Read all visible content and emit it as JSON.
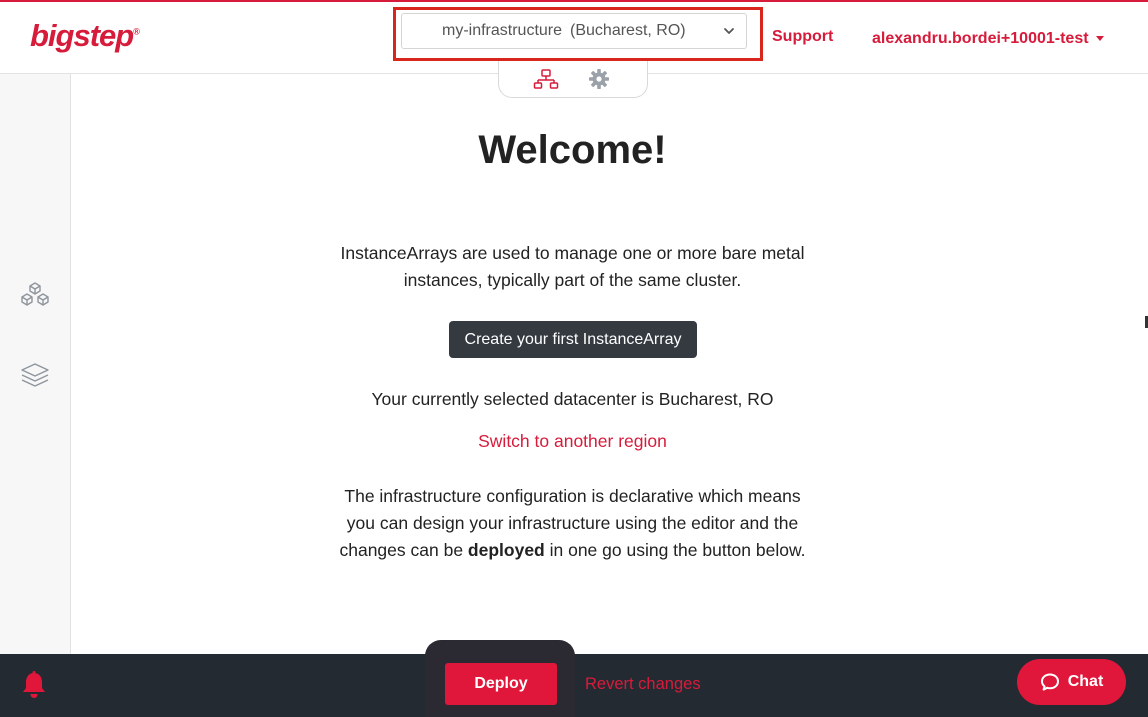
{
  "header": {
    "logo_text": "bigstep",
    "logo_mark": "®",
    "infrastructure_select": {
      "name": "my-infrastructure",
      "location": "(Bucharest, RO)"
    },
    "support_label": "Support",
    "user_label": "alexandru.bordei+10001-test"
  },
  "sidebar": {
    "items": [
      {
        "icon": "cubes-icon"
      },
      {
        "icon": "layers-icon"
      }
    ]
  },
  "view_toggle": {
    "items": [
      {
        "icon": "topology-icon",
        "active": true
      },
      {
        "icon": "gear-icon",
        "active": false
      }
    ]
  },
  "main": {
    "title": "Welcome!",
    "intro_line1": "InstanceArrays are used to manage one or more bare metal",
    "intro_line2": "instances, typically part of the same cluster.",
    "create_button_label": "Create your first InstanceArray",
    "datacenter_text": "Your currently selected datacenter is Bucharest, RO",
    "switch_region_label": "Switch to another region",
    "declarative_line1": "The infrastructure configuration is declarative which means",
    "declarative_line2": "you can design your infrastructure using the editor and the",
    "declarative_line3_pre": "changes can be ",
    "declarative_line3_bold": "deployed",
    "declarative_line3_post": " in one go using the button below."
  },
  "footer": {
    "deploy_label": "Deploy",
    "revert_label": "Revert changes",
    "chat_label": "Chat"
  },
  "colors": {
    "brand_red": "#d71b3b",
    "bottom_bar": "#242a32",
    "dark_button": "#343a40",
    "highlight_box": "#d9261c"
  }
}
